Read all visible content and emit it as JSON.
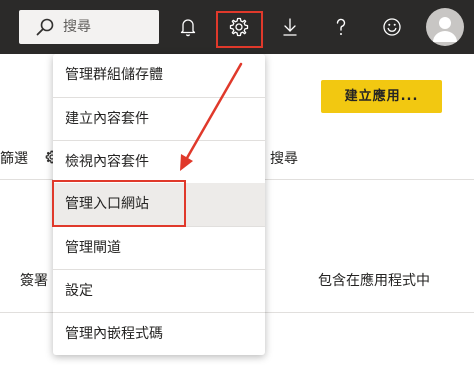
{
  "topbar": {
    "search_label": "搜尋",
    "icons": [
      "bell-icon",
      "gear-icon",
      "download-icon",
      "help-icon",
      "smiley-icon",
      "avatar-icon"
    ]
  },
  "background": {
    "create_app_button": "建立應用...",
    "filter_text_partial": "篩選",
    "search_text": "搜尋",
    "column_sign_partial": "簽署",
    "column_included": "包含在應用程式中"
  },
  "menu": {
    "items": [
      "管理群組儲存體",
      "建立內容套件",
      "檢視內容套件",
      "管理入口網站",
      "管理閘道",
      "設定",
      "管理內嵌程式碼"
    ],
    "highlighted_index": 3
  },
  "colors": {
    "topbar": "#2b2a29",
    "accent_yellow": "#f2c811",
    "annotation_red": "#e0392b"
  }
}
